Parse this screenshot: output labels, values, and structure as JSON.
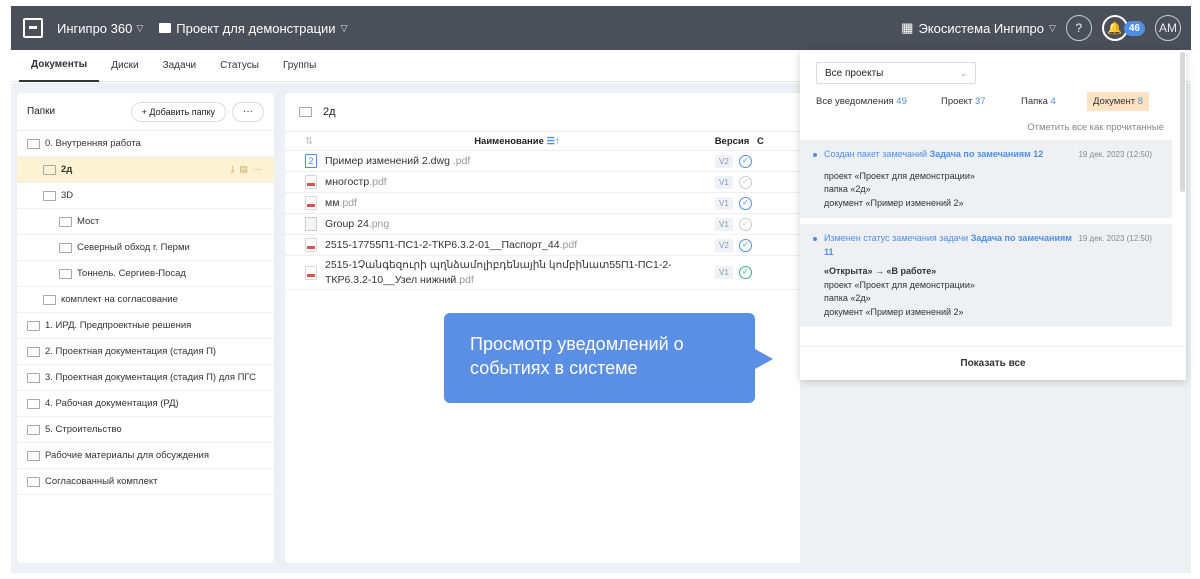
{
  "topbar": {
    "app_name": "Ингипро 360",
    "project": "Проект для демонстрации",
    "ecosystem": "Экосистема Ингипро",
    "help": "?",
    "notif_count": "46",
    "avatar": "AM"
  },
  "tabs": [
    "Документы",
    "Диски",
    "Задачи",
    "Статусы",
    "Группы"
  ],
  "folders": {
    "title": "Папки",
    "add_label": "+ Добавить папку",
    "more_label": "···",
    "items": [
      {
        "label": "0. Внутренняя работа",
        "level": 0
      },
      {
        "label": "2д",
        "level": 1,
        "selected": true
      },
      {
        "label": "3D",
        "level": 1
      },
      {
        "label": "Мост",
        "level": 2
      },
      {
        "label": "Северный обход г. Перми",
        "level": 2
      },
      {
        "label": "Тоннель. Сергиев-Посад",
        "level": 2
      },
      {
        "label": "комплект на согласование",
        "level": 1
      },
      {
        "label": "1. ИРД. Предпроектные решения",
        "level": 0
      },
      {
        "label": "2. Проектная документация (стадия П)",
        "level": 0
      },
      {
        "label": "3. Проектная документация (стадия П) для ПГС",
        "level": 0
      },
      {
        "label": "4. Рабочая документация (РД)",
        "level": 0
      },
      {
        "label": "5. Строительство",
        "level": 0
      },
      {
        "label": "Рабочие материалы для обсуждения",
        "level": 0
      },
      {
        "label": "Согласованный комплект",
        "level": 0
      }
    ]
  },
  "main": {
    "crumb": "2д",
    "crumb_sub": "...",
    "col_name": "Наименование",
    "col_version": "Версия",
    "col_partial": "С",
    "files": [
      {
        "name": "Пример изменений 2.dwg",
        "ext": " .pdf",
        "icon": "dwg",
        "version": "V2",
        "status": "blue"
      },
      {
        "name": "многостр",
        "ext": ".pdf",
        "icon": "pdf",
        "version": "V1",
        "status": "grey"
      },
      {
        "name": "мм",
        "ext": ".pdf",
        "icon": "pdf",
        "version": "V1",
        "status": "blue"
      },
      {
        "name": "Group 24",
        "ext": ".png",
        "icon": "png",
        "version": "V1",
        "status": "grey"
      },
      {
        "name": "2515-17755П1-ПС1-2-ТКР6.3.2-01__Паспорт_44",
        "ext": ".pdf",
        "icon": "pdf",
        "version": "V2",
        "status": "blue"
      },
      {
        "name": "2515-1Չանգեզուրի պղնձամոլիբդենային կոմբինատ55П1-ПС1-2-ТКР6.3.2-10__Узел нижний",
        "ext": ".pdf",
        "icon": "pdf",
        "version": "V1",
        "status": "green"
      }
    ]
  },
  "callout": {
    "text": "Просмотр уведомлений о событиях в системе"
  },
  "notifications": {
    "project_select": "Все проекты",
    "filters": [
      {
        "label": "Все уведомления",
        "count": "49"
      },
      {
        "label": "Проект",
        "count": "37"
      },
      {
        "label": "Папка",
        "count": "4"
      },
      {
        "label": "Документ",
        "count": "8"
      }
    ],
    "mark_all": "Отметить все как прочитанные",
    "items": [
      {
        "title_pre": "Создан пакет замечаний ",
        "title_bold": "Задача по замечаниям 12",
        "date": "19 дек. 2023 (12:50)",
        "lines": [
          "проект «Проект для демонстрации»",
          "папка «2д»",
          "документ «Пример изменений 2»"
        ]
      },
      {
        "title_pre": "Изменен статус замечания задачи ",
        "title_bold": "Задача по замечаниям 11",
        "date": "19 дек. 2023 (12:50)",
        "status_change": "«Открыта» → «В работе»",
        "lines": [
          "проект «Проект для демонстрации»",
          "папка «2д»",
          "документ «Пример изменений 2»"
        ]
      }
    ],
    "show_all": "Показать все"
  },
  "colors": {
    "topbar": "#4a4f59",
    "accent": "#4d8fe6",
    "selected_row": "#fcf3d4",
    "callout": "#5b8fe5"
  }
}
